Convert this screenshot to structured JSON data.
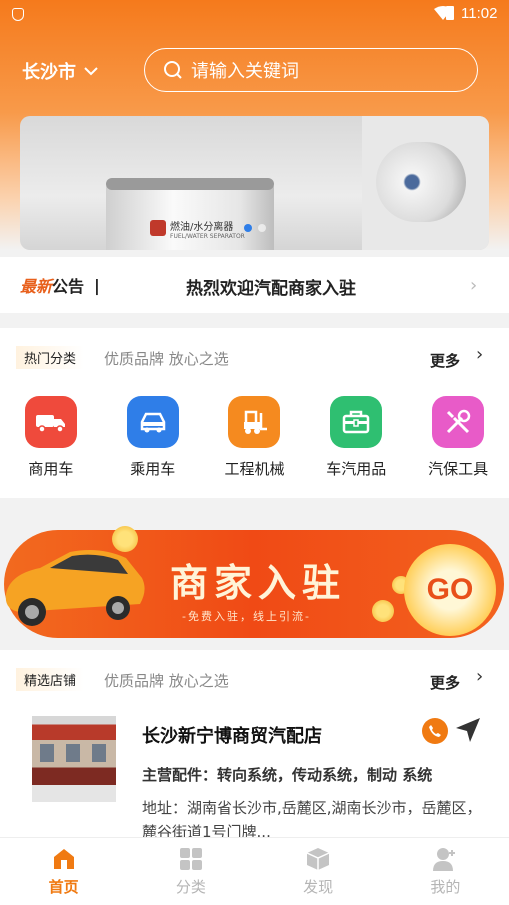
{
  "status_bar": {
    "time": "11:02"
  },
  "header": {
    "city": "长沙市",
    "search_placeholder": "请输入关键词"
  },
  "banner": {
    "product_label": "燃油/水分离器",
    "product_sublabel": "FUEL/WATER SEPARATOR",
    "dots": 2,
    "active_dot": 0
  },
  "notice": {
    "tag_latest": "最新",
    "tag_announce": "公告",
    "separator": "|",
    "text": "热烈欢迎汽配商家入驻"
  },
  "hot_categories": {
    "tag": "热门分类",
    "subtitle": "优质品牌 放心之选",
    "more": "更多",
    "items": [
      {
        "label": "商用车",
        "icon": "truck-icon",
        "color": "#ef4a3c"
      },
      {
        "label": "乘用车",
        "icon": "car-icon",
        "color": "#2f7ee8"
      },
      {
        "label": "工程机械",
        "icon": "forklift-icon",
        "color": "#f58a1f"
      },
      {
        "label": "车汽用品",
        "icon": "toolbox-icon",
        "color": "#2fbf71"
      },
      {
        "label": "汽保工具",
        "icon": "tools-icon",
        "color": "#e85bc8"
      }
    ]
  },
  "promo": {
    "title": "商家入驻",
    "subtitle": "-免费入驻，线上引流-",
    "go": "GO"
  },
  "featured_shops": {
    "tag": "精选店铺",
    "subtitle": "优质品牌 放心之选",
    "more": "更多",
    "shops": [
      {
        "name": "长沙新宁博商贸汽配店",
        "parts": "主营配件：转向系统，传动系统，制动 系统",
        "address": "地址：湖南省长沙市,岳麓区,湖南长沙市，岳麓区，麓谷街道1号门牌..."
      }
    ]
  },
  "tabbar": {
    "items": [
      {
        "label": "首页",
        "icon": "home-icon",
        "active": true
      },
      {
        "label": "分类",
        "icon": "grid-icon",
        "active": false
      },
      {
        "label": "发现",
        "icon": "cube-icon",
        "active": false
      },
      {
        "label": "我的",
        "icon": "person-icon",
        "active": false
      }
    ]
  },
  "colors": {
    "accent": "#f07a12",
    "header_top": "#f57a1c",
    "inactive_tab": "#b5b5b5"
  }
}
